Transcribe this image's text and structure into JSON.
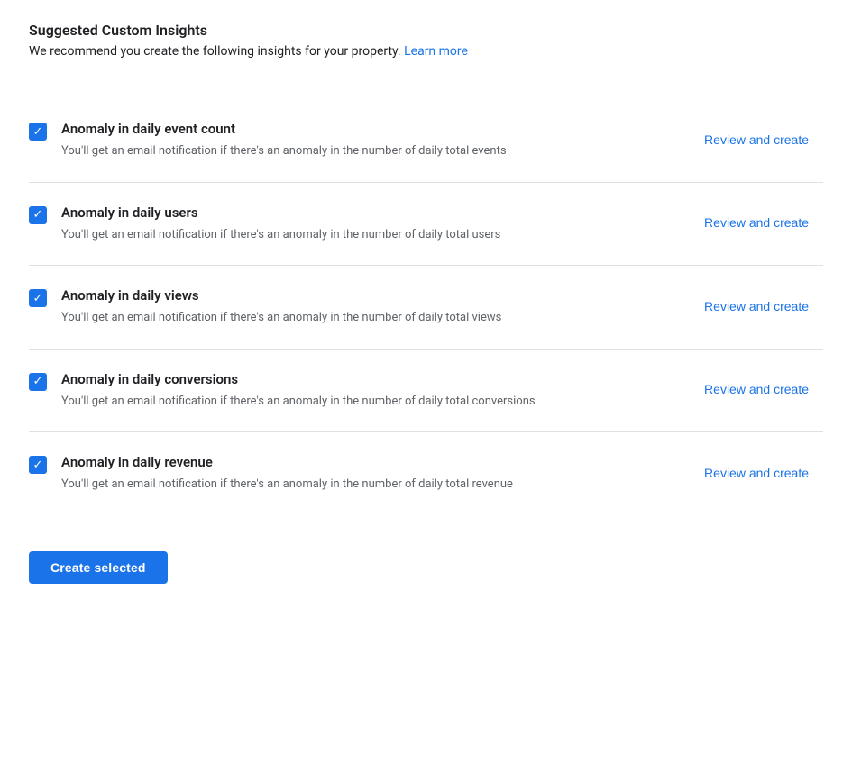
{
  "page": {
    "title": "Suggested Custom Insights",
    "subtitle": "We recommend you create the following insights for your property.",
    "learn_more_label": "Learn more",
    "divider": true
  },
  "insights": [
    {
      "id": "daily-event-count",
      "checked": true,
      "title": "Anomaly in daily event count",
      "description": "You'll get an email notification if there's an anomaly in the number of daily total events",
      "review_label": "Review and create"
    },
    {
      "id": "daily-users",
      "checked": true,
      "title": "Anomaly in daily users",
      "description": "You'll get an email notification if there's an anomaly in the number of daily total users",
      "review_label": "Review and create"
    },
    {
      "id": "daily-views",
      "checked": true,
      "title": "Anomaly in daily views",
      "description": "You'll get an email notification if there's an anomaly in the number of daily total views",
      "review_label": "Review and create"
    },
    {
      "id": "daily-conversions",
      "checked": true,
      "title": "Anomaly in daily conversions",
      "description": "You'll get an email notification if there's an anomaly in the number of daily total conversions",
      "review_label": "Review and create"
    },
    {
      "id": "daily-revenue",
      "checked": true,
      "title": "Anomaly in daily revenue",
      "description": "You'll get an email notification if there's an anomaly in the number of daily total revenue",
      "review_label": "Review and create"
    }
  ],
  "footer": {
    "create_selected_label": "Create selected"
  },
  "colors": {
    "accent": "#1a73e8",
    "text_primary": "#202124",
    "text_secondary": "#5f6368",
    "divider": "#e0e0e0"
  }
}
